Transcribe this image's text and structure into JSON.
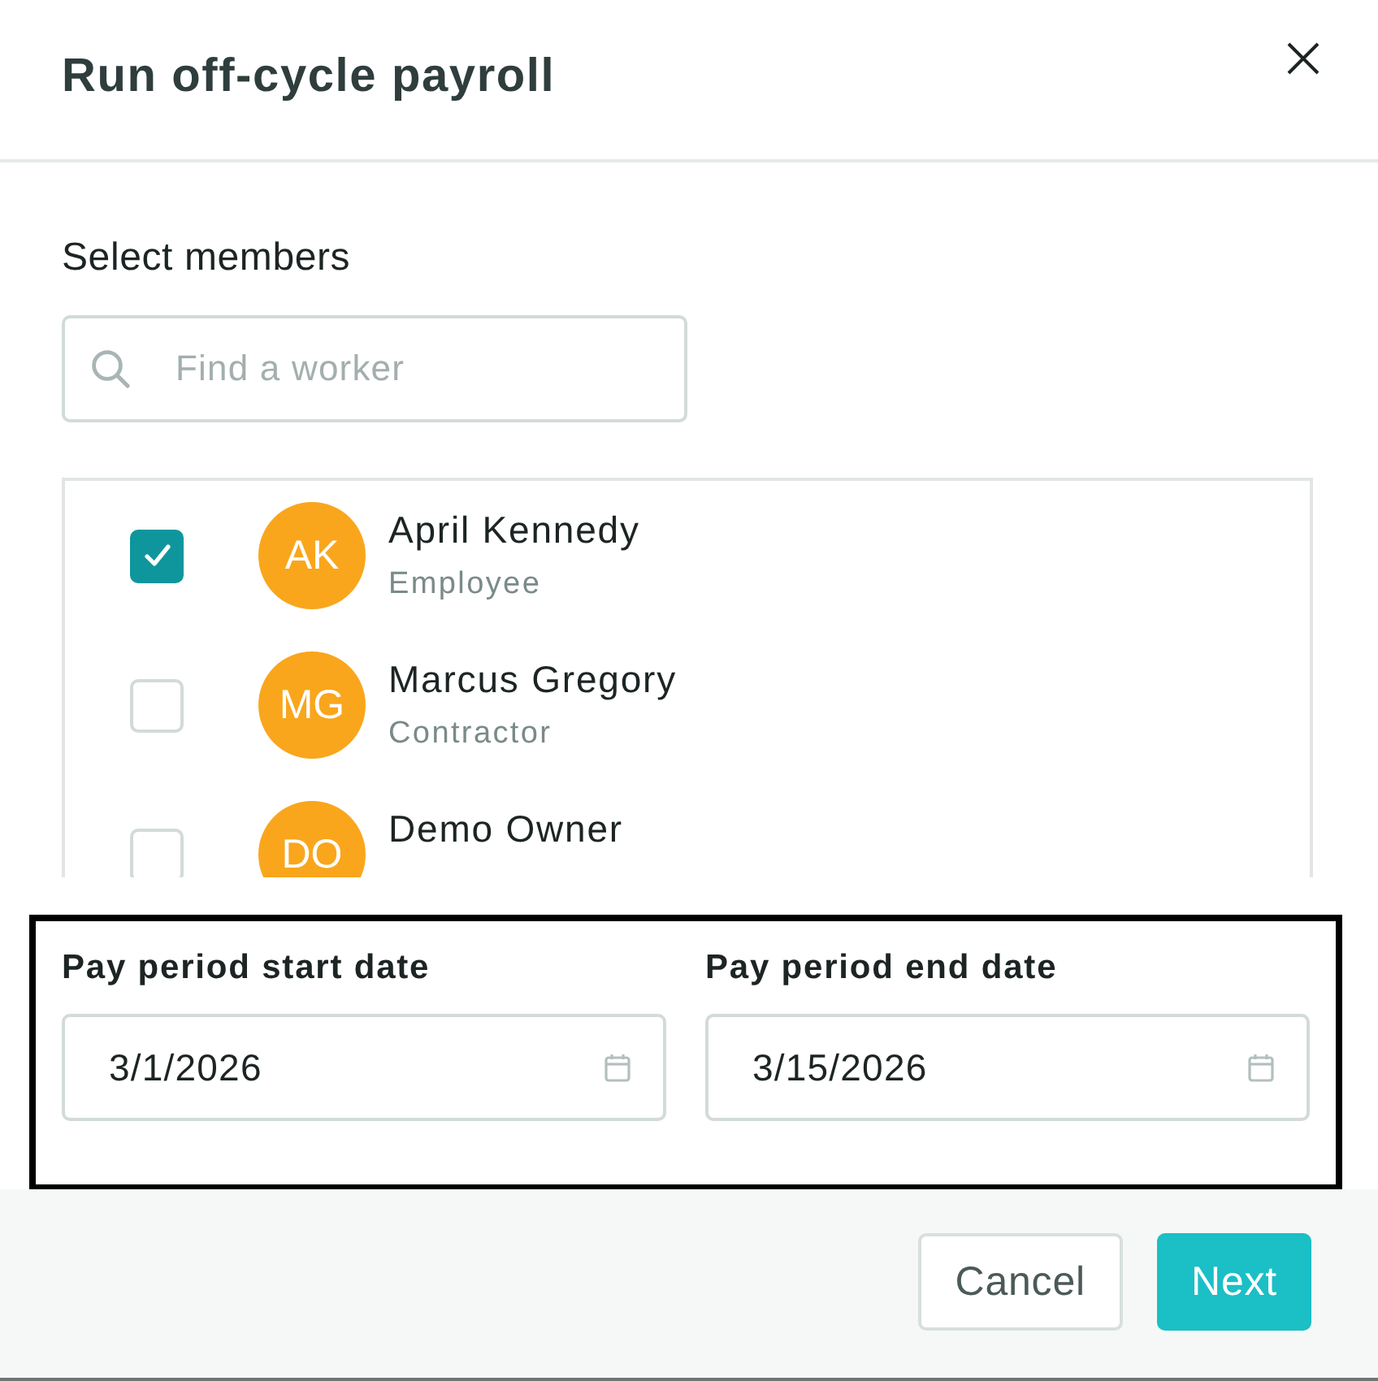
{
  "dialog": {
    "title": "Run off-cycle payroll"
  },
  "members": {
    "heading": "Select members",
    "search": {
      "placeholder": "Find a worker"
    },
    "list": [
      {
        "name": "April Kennedy",
        "role": "Employee",
        "initials": "AK",
        "checked": true
      },
      {
        "name": "Marcus Gregory",
        "role": "Contractor",
        "initials": "MG",
        "checked": false
      },
      {
        "name": "Demo Owner",
        "initials": "DO",
        "checked": false
      }
    ]
  },
  "pay_period": {
    "highlighted": true,
    "fields": [
      {
        "label": "Pay period start date",
        "value": "3/1/2026"
      },
      {
        "label": "Pay period end date",
        "value": "3/15/2026"
      }
    ]
  },
  "buttons": [
    {
      "label": "Cancel",
      "kind": "secondary"
    },
    {
      "label": "Next",
      "kind": "primary"
    }
  ]
}
